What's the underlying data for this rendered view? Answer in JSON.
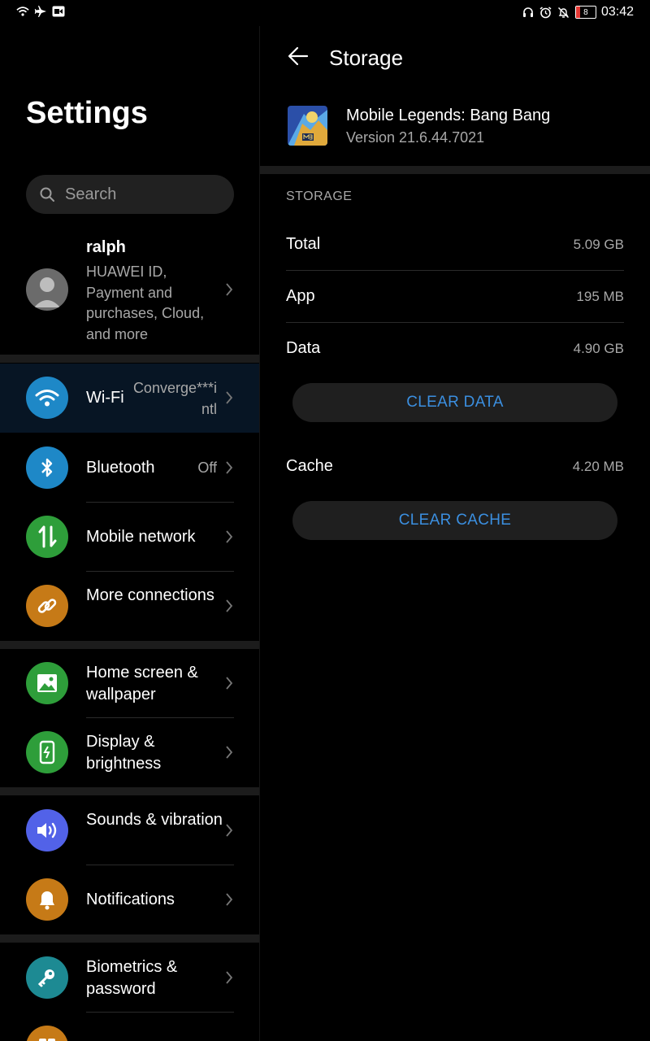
{
  "status_bar": {
    "time": "03:42",
    "battery_level": "8",
    "left_icons": [
      "wifi-icon",
      "airplane-icon",
      "screen-record-icon"
    ],
    "right_icons": [
      "headset-icon",
      "alarm-icon",
      "notifications-off-icon",
      "battery-icon"
    ]
  },
  "settings": {
    "title": "Settings",
    "search_placeholder": "Search",
    "account": {
      "name": "ralph",
      "description": "HUAWEI ID, Payment and purchases, Cloud, and more"
    },
    "items": [
      {
        "label": "Wi-Fi",
        "value": "Converge***intl",
        "icon": "wifi-icon",
        "color": "#1e88c7"
      },
      {
        "label": "Bluetooth",
        "value": "Off",
        "icon": "bluetooth-icon",
        "color": "#1e88c7"
      },
      {
        "label": "Mobile network",
        "value": "",
        "icon": "mobile-data-icon",
        "color": "#2e9e3a"
      },
      {
        "label": "More connections",
        "value": "",
        "icon": "link-icon",
        "color": "#c67a17"
      },
      {
        "label": "Home screen & wallpaper",
        "value": "",
        "icon": "image-icon",
        "color": "#2e9e3a"
      },
      {
        "label": "Display & brightness",
        "value": "",
        "icon": "display-icon",
        "color": "#2e9e3a"
      },
      {
        "label": "Sounds & vibration",
        "value": "",
        "icon": "speaker-icon",
        "color": "#5262e8"
      },
      {
        "label": "Notifications",
        "value": "",
        "icon": "bell-icon",
        "color": "#c67a17"
      },
      {
        "label": "Biometrics & password",
        "value": "",
        "icon": "key-icon",
        "color": "#1d8a93"
      }
    ]
  },
  "storage": {
    "title": "Storage",
    "app_name": "Mobile Legends: Bang Bang",
    "app_version": "Version 21.6.44.7021",
    "section_label": "STORAGE",
    "total_label": "Total",
    "total_value": "5.09 GB",
    "app_label": "App",
    "app_value": "195 MB",
    "data_label": "Data",
    "data_value": "4.90 GB",
    "clear_data_label": "CLEAR DATA",
    "cache_label": "Cache",
    "cache_value": "4.20 MB",
    "clear_cache_label": "CLEAR CACHE",
    "accent_color": "#3b8fe0"
  }
}
